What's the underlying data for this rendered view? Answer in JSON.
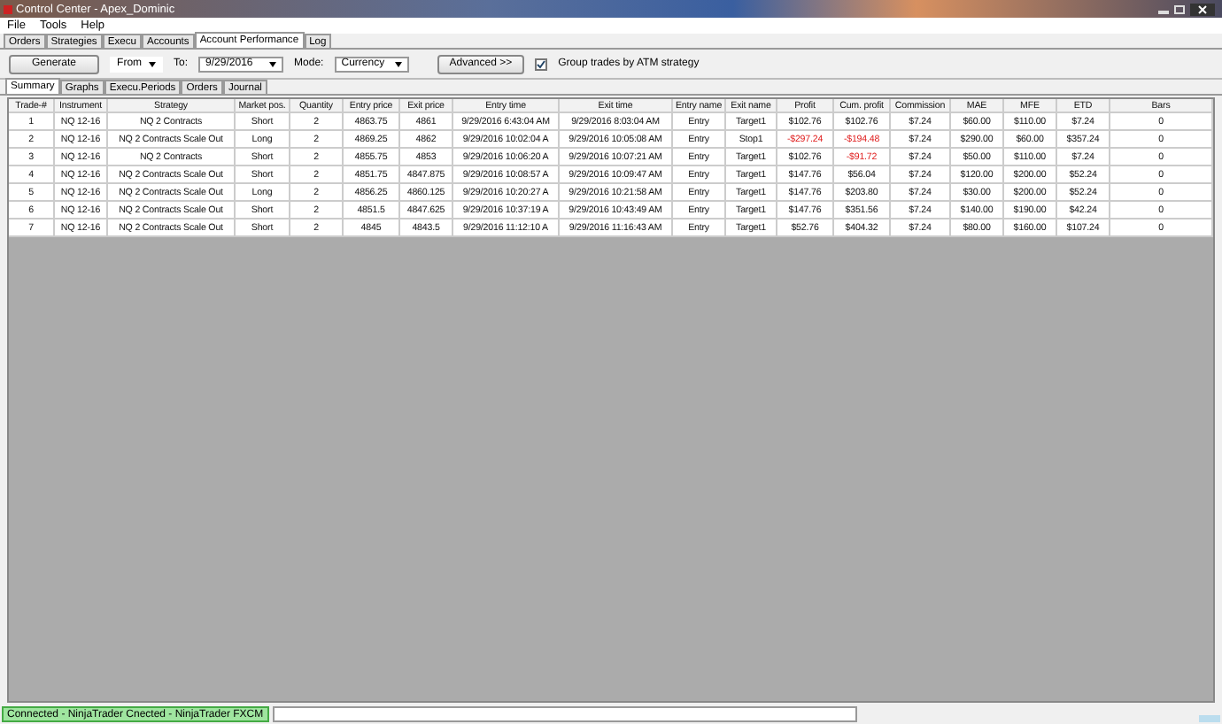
{
  "window": {
    "title": "Control Center - Apex_Dominic"
  },
  "menu": [
    "File",
    "Tools",
    "Help"
  ],
  "tabs": [
    {
      "label": "Orders",
      "selected": false
    },
    {
      "label": "Strategies",
      "selected": false
    },
    {
      "label": "Execu",
      "selected": false
    },
    {
      "label": "Accounts",
      "selected": false
    },
    {
      "label": "Account Performance",
      "selected": true
    },
    {
      "label": "Log",
      "selected": false
    }
  ],
  "toolbar": {
    "generate": "Generate",
    "from": "From",
    "to_label": "To:",
    "to_date": "9/29/2016",
    "mode_label": "Mode:",
    "mode": "Currency",
    "advanced": "Advanced >>",
    "group_label": "Group trades by ATM strategy",
    "group_checked": true
  },
  "subtabs": [
    {
      "label": "Summary",
      "selected": true
    },
    {
      "label": "Graphs",
      "selected": false
    },
    {
      "label": "Execu.Periods",
      "selected": false
    },
    {
      "label": "Orders",
      "selected": false
    },
    {
      "label": "Journal",
      "selected": false
    }
  ],
  "table": {
    "columns": [
      "Trade-#",
      "Instrument",
      "Strategy",
      "Market pos.",
      "Quantity",
      "Entry price",
      "Exit price",
      "Entry time",
      "Exit time",
      "Entry name",
      "Exit name",
      "Profit",
      "Cum. profit",
      "Commission",
      "MAE",
      "MFE",
      "ETD",
      "Bars"
    ],
    "rows": [
      {
        "cells": [
          "1",
          "NQ 12-16",
          "NQ 2 Contracts",
          "Short",
          "2",
          "4863.75",
          "4861",
          "9/29/2016 6:43:04 AM",
          "9/29/2016 8:03:04 AM",
          "Entry",
          "Target1",
          "$102.76",
          "$102.76",
          "$7.24",
          "$60.00",
          "$110.00",
          "$7.24",
          "0"
        ],
        "negative": [
          false,
          false
        ]
      },
      {
        "cells": [
          "2",
          "NQ 12-16",
          "NQ 2 Contracts Scale Out",
          "Long",
          "2",
          "4869.25",
          "4862",
          "9/29/2016 10:02:04 A",
          "9/29/2016 10:05:08 AM",
          "Entry",
          "Stop1",
          "-$297.24",
          "-$194.48",
          "$7.24",
          "$290.00",
          "$60.00",
          "$357.24",
          "0"
        ],
        "negative": [
          true,
          true
        ]
      },
      {
        "cells": [
          "3",
          "NQ 12-16",
          "NQ 2 Contracts",
          "Short",
          "2",
          "4855.75",
          "4853",
          "9/29/2016 10:06:20 A",
          "9/29/2016 10:07:21 AM",
          "Entry",
          "Target1",
          "$102.76",
          "-$91.72",
          "$7.24",
          "$50.00",
          "$110.00",
          "$7.24",
          "0"
        ],
        "negative": [
          false,
          true
        ]
      },
      {
        "cells": [
          "4",
          "NQ 12-16",
          "NQ 2 Contracts Scale Out",
          "Short",
          "2",
          "4851.75",
          "4847.875",
          "9/29/2016 10:08:57 A",
          "9/29/2016 10:09:47 AM",
          "Entry",
          "Target1",
          "$147.76",
          "$56.04",
          "$7.24",
          "$120.00",
          "$200.00",
          "$52.24",
          "0"
        ],
        "negative": [
          false,
          false
        ]
      },
      {
        "cells": [
          "5",
          "NQ 12-16",
          "NQ 2 Contracts Scale Out",
          "Long",
          "2",
          "4856.25",
          "4860.125",
          "9/29/2016 10:20:27 A",
          "9/29/2016 10:21:58 AM",
          "Entry",
          "Target1",
          "$147.76",
          "$203.80",
          "$7.24",
          "$30.00",
          "$200.00",
          "$52.24",
          "0"
        ],
        "negative": [
          false,
          false
        ]
      },
      {
        "cells": [
          "6",
          "NQ 12-16",
          "NQ 2 Contracts Scale Out",
          "Short",
          "2",
          "4851.5",
          "4847.625",
          "9/29/2016 10:37:19 A",
          "9/29/2016 10:43:49 AM",
          "Entry",
          "Target1",
          "$147.76",
          "$351.56",
          "$7.24",
          "$140.00",
          "$190.00",
          "$42.24",
          "0"
        ],
        "negative": [
          false,
          false
        ]
      },
      {
        "cells": [
          "7",
          "NQ 12-16",
          "NQ 2 Contracts Scale Out",
          "Short",
          "2",
          "4845",
          "4843.5",
          "9/29/2016 11:12:10 A",
          "9/29/2016 11:16:43 AM",
          "Entry",
          "Target1",
          "$52.76",
          "$404.32",
          "$7.24",
          "$80.00",
          "$160.00",
          "$107.24",
          "0"
        ],
        "negative": [
          false,
          false
        ]
      }
    ]
  },
  "status_bar": "Connected - NinjaTrader Cnected - NinjaTrader FXCM"
}
